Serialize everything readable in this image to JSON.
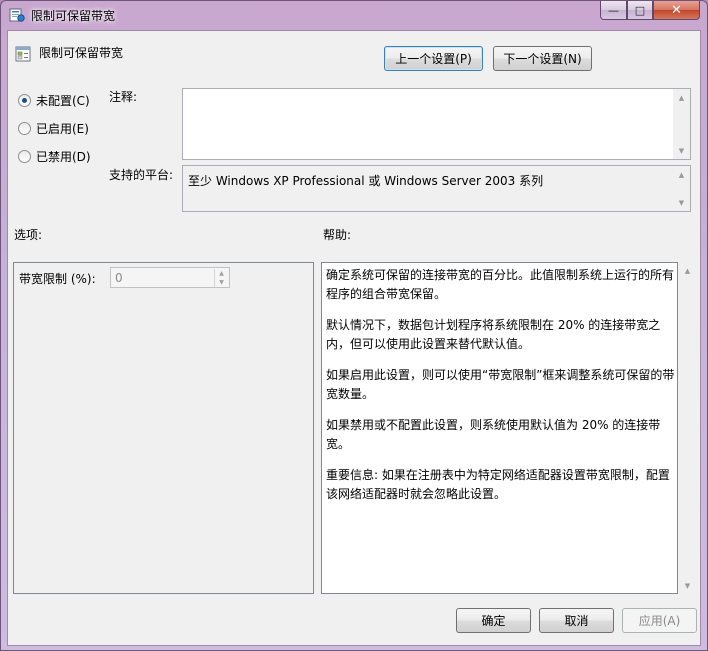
{
  "window": {
    "title": "限制可保留带宽",
    "controls": {
      "minimize": "—",
      "maximize": "□",
      "close": "✕"
    }
  },
  "setting": {
    "title": "限制可保留带宽",
    "prev_label": "上一个设置(P)",
    "next_label": "下一个设置(N)"
  },
  "state": {
    "options": [
      {
        "label": "未配置(C)",
        "selected": true
      },
      {
        "label": "已启用(E)",
        "selected": false
      },
      {
        "label": "已禁用(D)",
        "selected": false
      }
    ]
  },
  "comment": {
    "label": "注释:",
    "value": ""
  },
  "platform": {
    "label": "支持的平台:",
    "value": "至少 Windows XP Professional 或 Windows Server 2003 系列"
  },
  "options_section": {
    "heading": "选项:",
    "bandwidth_label": "带宽限制 (%):",
    "bandwidth_value": "0"
  },
  "help_section": {
    "heading": "帮助:",
    "paragraphs": [
      "确定系统可保留的连接带宽的百分比。此值限制系统上运行的所有程序的组合带宽保留。",
      "默认情况下，数据包计划程序将系统限制在 20% 的连接带宽之内，但可以使用此设置来替代默认值。",
      "如果启用此设置，则可以使用“带宽限制”框来调整系统可保留的带宽数量。",
      "如果禁用或不配置此设置，则系统使用默认值为 20% 的连接带宽。",
      "重要信息: 如果在注册表中为特定网络适配器设置带宽限制，配置该网络适配器时就会忽略此设置。"
    ]
  },
  "footer": {
    "ok_label": "确定",
    "cancel_label": "取消",
    "apply_label": "应用(A)"
  },
  "colors": {
    "title_gradient": "#c9a7cf",
    "client_bg": "#f0f0f0",
    "close_button": "#c2462b",
    "radio_dot": "#1c5180"
  }
}
